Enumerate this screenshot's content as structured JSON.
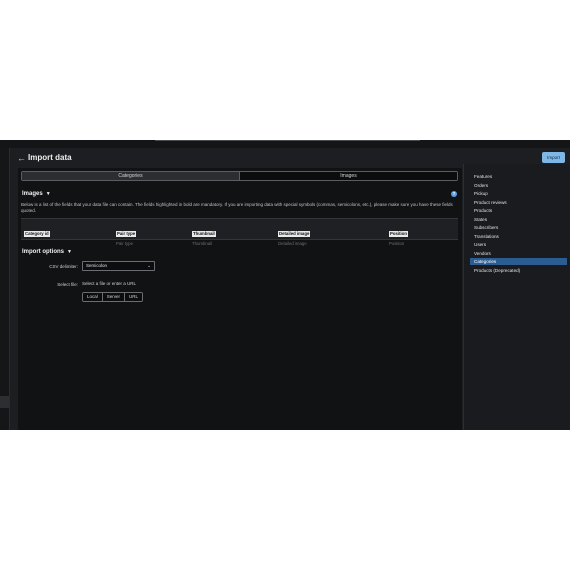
{
  "header": {
    "back_icon": "arrow-left-icon",
    "title": "Import data",
    "import_label": "Import"
  },
  "tabs": [
    {
      "label": "Categories",
      "active": false
    },
    {
      "label": "Images",
      "active": true
    }
  ],
  "images_section": {
    "title": "Images",
    "help_icon": "question-circle-icon",
    "help_glyph": "?",
    "description": "Below is a list of the fields that your data file can contain. The fields highlighted in bold are mandatory. If you are importing data with special symbols (commas, semicolons, etc.), please make sure you have these fields quoted.",
    "fields": [
      {
        "label": "Category id",
        "sub": ""
      },
      {
        "label": "Pair type",
        "sub": "Pair type"
      },
      {
        "label": "Thumbnail",
        "sub": "Thumbnail"
      },
      {
        "label": "Detailed image",
        "sub": "Detailed image"
      },
      {
        "label": "Position",
        "sub": "Position"
      }
    ]
  },
  "import_options": {
    "title": "Import options",
    "csv_delimiter_label": "CSV delimiter:",
    "csv_delimiter_value": "Semicolon",
    "select_file_label": "Select file:",
    "select_file_hint": "Select a file or enter a URL",
    "file_sources": [
      "Local",
      "Server",
      "URL"
    ]
  },
  "sidebar": {
    "items": [
      {
        "label": "Features",
        "active": false
      },
      {
        "label": "Orders",
        "active": false
      },
      {
        "label": "Pickup",
        "active": false
      },
      {
        "label": "Product reviews",
        "active": false
      },
      {
        "label": "Products",
        "active": false
      },
      {
        "label": "States",
        "active": false
      },
      {
        "label": "Subscribers",
        "active": false
      },
      {
        "label": "Translations",
        "active": false
      },
      {
        "label": "Users",
        "active": false
      },
      {
        "label": "Vendors",
        "active": false
      },
      {
        "label": "Categories",
        "active": true
      },
      {
        "label": "Products (Deprecated)",
        "active": false
      }
    ]
  },
  "colors": {
    "accent": "#7fb7e6",
    "active_item": "#2c5d92",
    "background": "#101214"
  }
}
